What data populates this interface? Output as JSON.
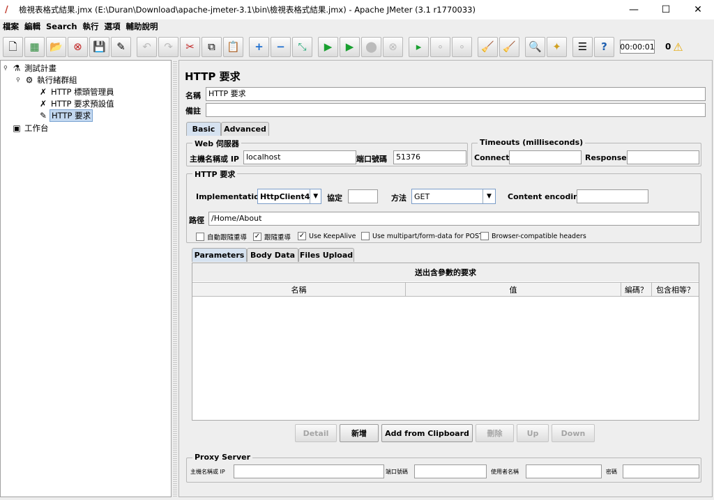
{
  "window": {
    "title": "檢視表格式結果.jmx (E:\\Duran\\Download\\apache-jmeter-3.1\\bin\\檢視表格式結果.jmx) - Apache JMeter (3.1 r1770033)",
    "minimize": "—",
    "maximize": "☐",
    "close": "✕"
  },
  "menu": {
    "items": [
      "檔案",
      "編輯",
      "Search",
      "執行",
      "選項",
      "輔助說明"
    ]
  },
  "toolbar": {
    "timer": "00:00:01",
    "warning_count": "0"
  },
  "tree": {
    "nodes": [
      {
        "label": "測試計畫",
        "icon": "flask-icon"
      },
      {
        "label": "執行緒群組",
        "icon": "gear-icon"
      },
      {
        "label": "HTTP 標頭管理員",
        "icon": "tools-icon"
      },
      {
        "label": "HTTP 要求預設值",
        "icon": "tools-icon"
      },
      {
        "label": "HTTP 要求",
        "icon": "pipette-icon"
      },
      {
        "label": "工作台",
        "icon": "workbench-icon"
      }
    ]
  },
  "panel": {
    "title": "HTTP 要求",
    "name_label": "名稱",
    "name_value": "HTTP 要求",
    "comment_label": "備註",
    "comment_value": "",
    "tabs": [
      "Basic",
      "Advanced"
    ],
    "web_server": {
      "title": "Web 伺服器",
      "host_label": "主機名稱或 IP",
      "host_value": "localhost",
      "port_label": "端口號碼",
      "port_value": "51376"
    },
    "timeouts": {
      "title": "Timeouts (milliseconds)",
      "connect_label": "Connect:",
      "connect_value": "",
      "response_label": "Response:",
      "response_value": ""
    },
    "http_request": {
      "title": "HTTP 要求",
      "implementation_label": "Implementation:",
      "implementation_value": "HttpClient4",
      "protocol_label": "協定",
      "protocol_value": "",
      "method_label": "方法",
      "method_value": "GET",
      "encoding_label": "Content encoding:",
      "encoding_value": "",
      "path_label": "路徑",
      "path_value": "/Home/About"
    },
    "checkboxes": [
      {
        "label": "自動跟隨重導",
        "checked": false
      },
      {
        "label": "跟隨重導",
        "checked": true
      },
      {
        "label": "Use KeepAlive",
        "checked": true
      },
      {
        "label": "Use multipart/form-data for POST",
        "checked": false
      },
      {
        "label": "Browser-compatible headers",
        "checked": false
      }
    ],
    "sub_tabs": [
      "Parameters",
      "Body Data",
      "Files Upload"
    ],
    "params_table": {
      "title": "送出含參數的要求",
      "columns": [
        "名稱",
        "值",
        "編碼？",
        "包含相等？"
      ]
    },
    "buttons": {
      "detail": "Detail",
      "add": "新增",
      "add_clipboard": "Add from Clipboard",
      "delete": "刪除",
      "up": "Up",
      "down": "Down"
    },
    "proxy": {
      "title": "Proxy Server",
      "host_label": "主機名稱或 IP",
      "port_label": "端口號碼",
      "user_label": "使用者名稱",
      "password_label": "密碼"
    }
  }
}
